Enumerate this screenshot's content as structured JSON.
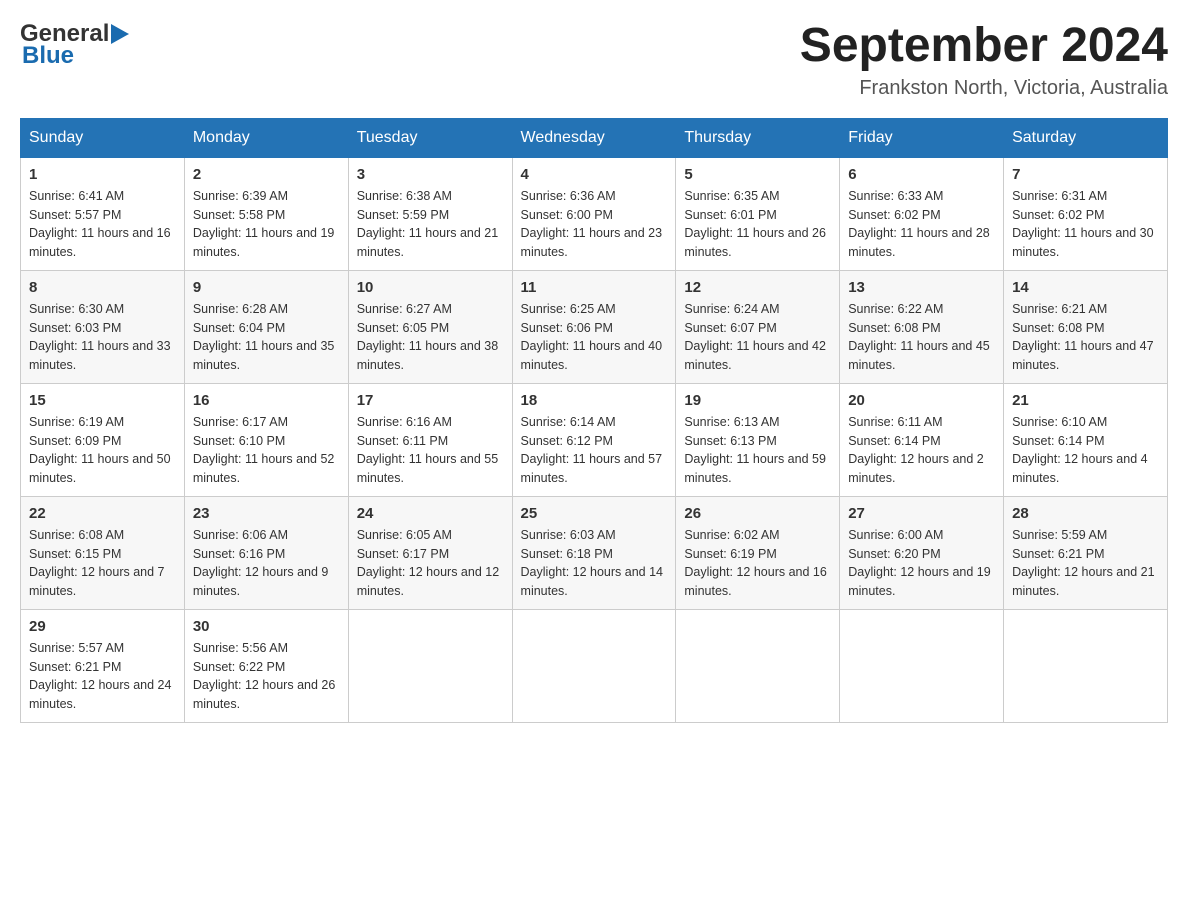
{
  "header": {
    "logo_text_general": "General",
    "logo_text_blue": "Blue",
    "month_title": "September 2024",
    "location": "Frankston North, Victoria, Australia"
  },
  "weekdays": [
    "Sunday",
    "Monday",
    "Tuesday",
    "Wednesday",
    "Thursday",
    "Friday",
    "Saturday"
  ],
  "weeks": [
    [
      {
        "day": "1",
        "sunrise": "Sunrise: 6:41 AM",
        "sunset": "Sunset: 5:57 PM",
        "daylight": "Daylight: 11 hours and 16 minutes."
      },
      {
        "day": "2",
        "sunrise": "Sunrise: 6:39 AM",
        "sunset": "Sunset: 5:58 PM",
        "daylight": "Daylight: 11 hours and 19 minutes."
      },
      {
        "day": "3",
        "sunrise": "Sunrise: 6:38 AM",
        "sunset": "Sunset: 5:59 PM",
        "daylight": "Daylight: 11 hours and 21 minutes."
      },
      {
        "day": "4",
        "sunrise": "Sunrise: 6:36 AM",
        "sunset": "Sunset: 6:00 PM",
        "daylight": "Daylight: 11 hours and 23 minutes."
      },
      {
        "day": "5",
        "sunrise": "Sunrise: 6:35 AM",
        "sunset": "Sunset: 6:01 PM",
        "daylight": "Daylight: 11 hours and 26 minutes."
      },
      {
        "day": "6",
        "sunrise": "Sunrise: 6:33 AM",
        "sunset": "Sunset: 6:02 PM",
        "daylight": "Daylight: 11 hours and 28 minutes."
      },
      {
        "day": "7",
        "sunrise": "Sunrise: 6:31 AM",
        "sunset": "Sunset: 6:02 PM",
        "daylight": "Daylight: 11 hours and 30 minutes."
      }
    ],
    [
      {
        "day": "8",
        "sunrise": "Sunrise: 6:30 AM",
        "sunset": "Sunset: 6:03 PM",
        "daylight": "Daylight: 11 hours and 33 minutes."
      },
      {
        "day": "9",
        "sunrise": "Sunrise: 6:28 AM",
        "sunset": "Sunset: 6:04 PM",
        "daylight": "Daylight: 11 hours and 35 minutes."
      },
      {
        "day": "10",
        "sunrise": "Sunrise: 6:27 AM",
        "sunset": "Sunset: 6:05 PM",
        "daylight": "Daylight: 11 hours and 38 minutes."
      },
      {
        "day": "11",
        "sunrise": "Sunrise: 6:25 AM",
        "sunset": "Sunset: 6:06 PM",
        "daylight": "Daylight: 11 hours and 40 minutes."
      },
      {
        "day": "12",
        "sunrise": "Sunrise: 6:24 AM",
        "sunset": "Sunset: 6:07 PM",
        "daylight": "Daylight: 11 hours and 42 minutes."
      },
      {
        "day": "13",
        "sunrise": "Sunrise: 6:22 AM",
        "sunset": "Sunset: 6:08 PM",
        "daylight": "Daylight: 11 hours and 45 minutes."
      },
      {
        "day": "14",
        "sunrise": "Sunrise: 6:21 AM",
        "sunset": "Sunset: 6:08 PM",
        "daylight": "Daylight: 11 hours and 47 minutes."
      }
    ],
    [
      {
        "day": "15",
        "sunrise": "Sunrise: 6:19 AM",
        "sunset": "Sunset: 6:09 PM",
        "daylight": "Daylight: 11 hours and 50 minutes."
      },
      {
        "day": "16",
        "sunrise": "Sunrise: 6:17 AM",
        "sunset": "Sunset: 6:10 PM",
        "daylight": "Daylight: 11 hours and 52 minutes."
      },
      {
        "day": "17",
        "sunrise": "Sunrise: 6:16 AM",
        "sunset": "Sunset: 6:11 PM",
        "daylight": "Daylight: 11 hours and 55 minutes."
      },
      {
        "day": "18",
        "sunrise": "Sunrise: 6:14 AM",
        "sunset": "Sunset: 6:12 PM",
        "daylight": "Daylight: 11 hours and 57 minutes."
      },
      {
        "day": "19",
        "sunrise": "Sunrise: 6:13 AM",
        "sunset": "Sunset: 6:13 PM",
        "daylight": "Daylight: 11 hours and 59 minutes."
      },
      {
        "day": "20",
        "sunrise": "Sunrise: 6:11 AM",
        "sunset": "Sunset: 6:14 PM",
        "daylight": "Daylight: 12 hours and 2 minutes."
      },
      {
        "day": "21",
        "sunrise": "Sunrise: 6:10 AM",
        "sunset": "Sunset: 6:14 PM",
        "daylight": "Daylight: 12 hours and 4 minutes."
      }
    ],
    [
      {
        "day": "22",
        "sunrise": "Sunrise: 6:08 AM",
        "sunset": "Sunset: 6:15 PM",
        "daylight": "Daylight: 12 hours and 7 minutes."
      },
      {
        "day": "23",
        "sunrise": "Sunrise: 6:06 AM",
        "sunset": "Sunset: 6:16 PM",
        "daylight": "Daylight: 12 hours and 9 minutes."
      },
      {
        "day": "24",
        "sunrise": "Sunrise: 6:05 AM",
        "sunset": "Sunset: 6:17 PM",
        "daylight": "Daylight: 12 hours and 12 minutes."
      },
      {
        "day": "25",
        "sunrise": "Sunrise: 6:03 AM",
        "sunset": "Sunset: 6:18 PM",
        "daylight": "Daylight: 12 hours and 14 minutes."
      },
      {
        "day": "26",
        "sunrise": "Sunrise: 6:02 AM",
        "sunset": "Sunset: 6:19 PM",
        "daylight": "Daylight: 12 hours and 16 minutes."
      },
      {
        "day": "27",
        "sunrise": "Sunrise: 6:00 AM",
        "sunset": "Sunset: 6:20 PM",
        "daylight": "Daylight: 12 hours and 19 minutes."
      },
      {
        "day": "28",
        "sunrise": "Sunrise: 5:59 AM",
        "sunset": "Sunset: 6:21 PM",
        "daylight": "Daylight: 12 hours and 21 minutes."
      }
    ],
    [
      {
        "day": "29",
        "sunrise": "Sunrise: 5:57 AM",
        "sunset": "Sunset: 6:21 PM",
        "daylight": "Daylight: 12 hours and 24 minutes."
      },
      {
        "day": "30",
        "sunrise": "Sunrise: 5:56 AM",
        "sunset": "Sunset: 6:22 PM",
        "daylight": "Daylight: 12 hours and 26 minutes."
      },
      null,
      null,
      null,
      null,
      null
    ]
  ]
}
